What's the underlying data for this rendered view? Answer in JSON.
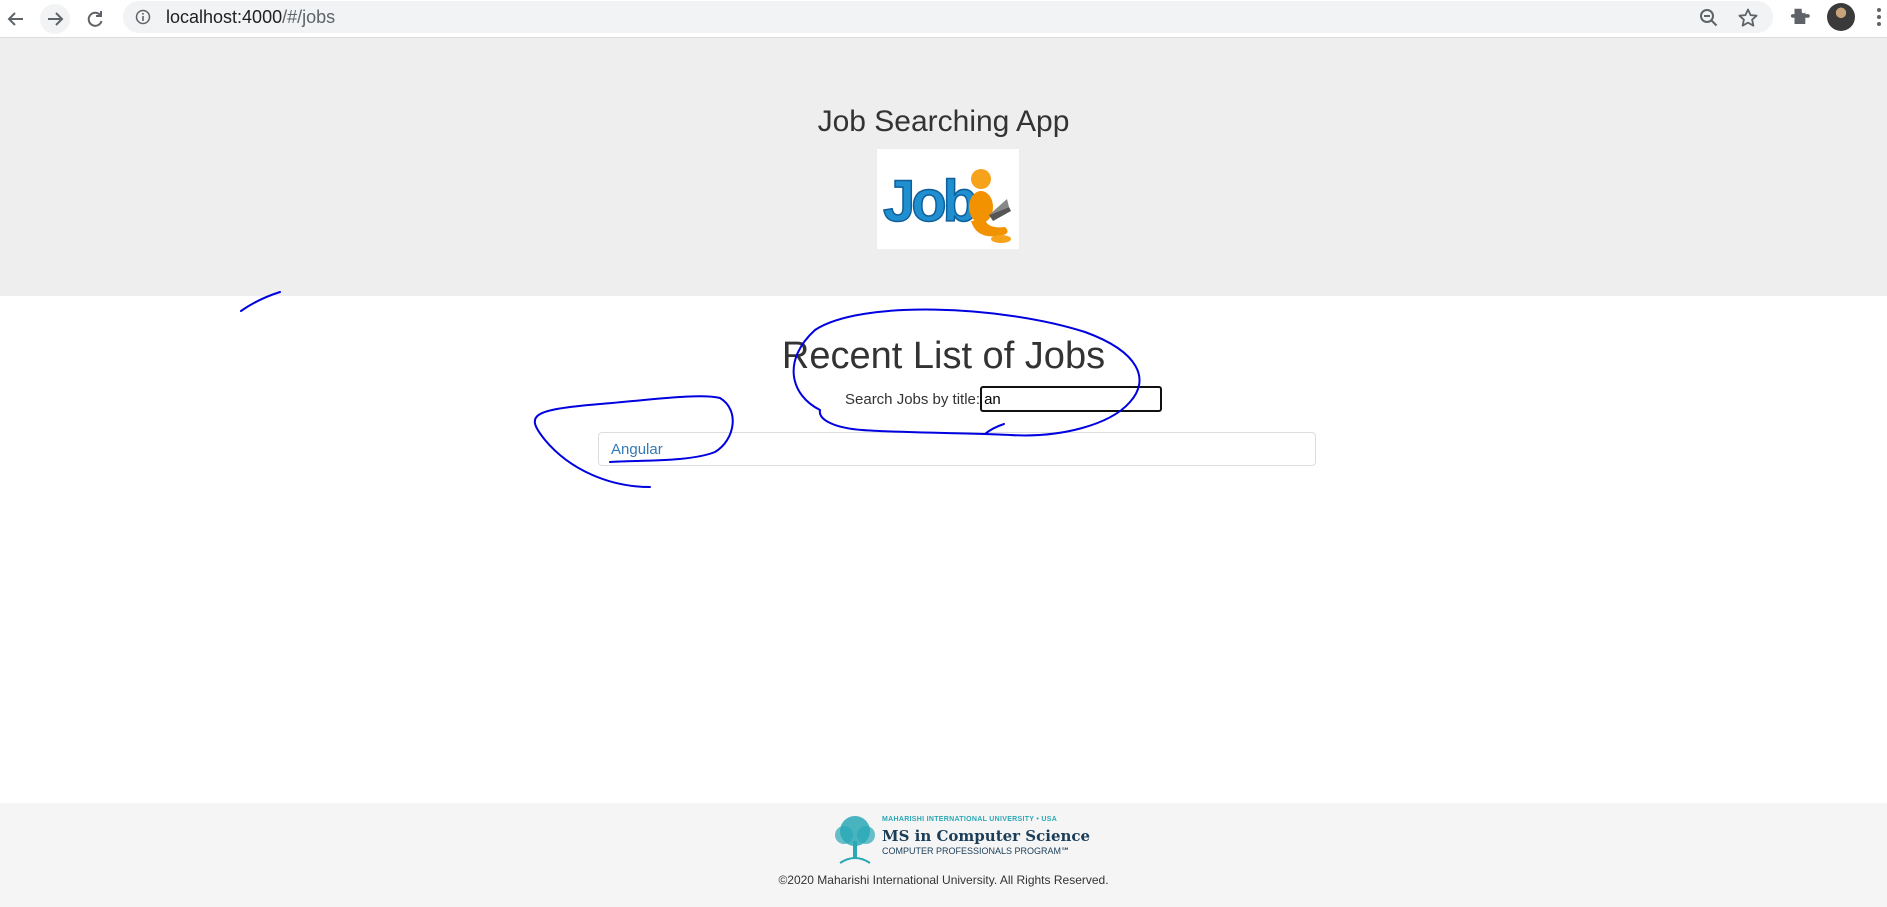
{
  "browser": {
    "url_host": "localhost:4000",
    "url_path": "/#/jobs",
    "icons": [
      "back-arrow-icon",
      "forward-arrow-icon",
      "reload-icon",
      "site-info-icon",
      "zoom-icon",
      "star-icon",
      "extensions-icon",
      "profile-avatar",
      "menu-icon"
    ]
  },
  "header": {
    "title": "Job Searching App",
    "logo_alt": "Jobs"
  },
  "main": {
    "heading": "Recent List of Jobs",
    "search_label": "Search Jobs by title:",
    "search_value": "an",
    "jobs": [
      "Angular"
    ]
  },
  "footer": {
    "logo_small": "MAHARISHI INTERNATIONAL UNIVERSITY • USA",
    "logo_big": "MS in Computer Science",
    "logo_sub": "COMPUTER PROFESSIONALS PROGRAM℠",
    "copyright": "©2020 Maharishi International University. All Rights Reserved."
  },
  "colors": {
    "header_bg": "#eeeeee",
    "link": "#337ab7",
    "annotation_ink": "#0000e0",
    "footer_bg": "#f5f5f5"
  }
}
